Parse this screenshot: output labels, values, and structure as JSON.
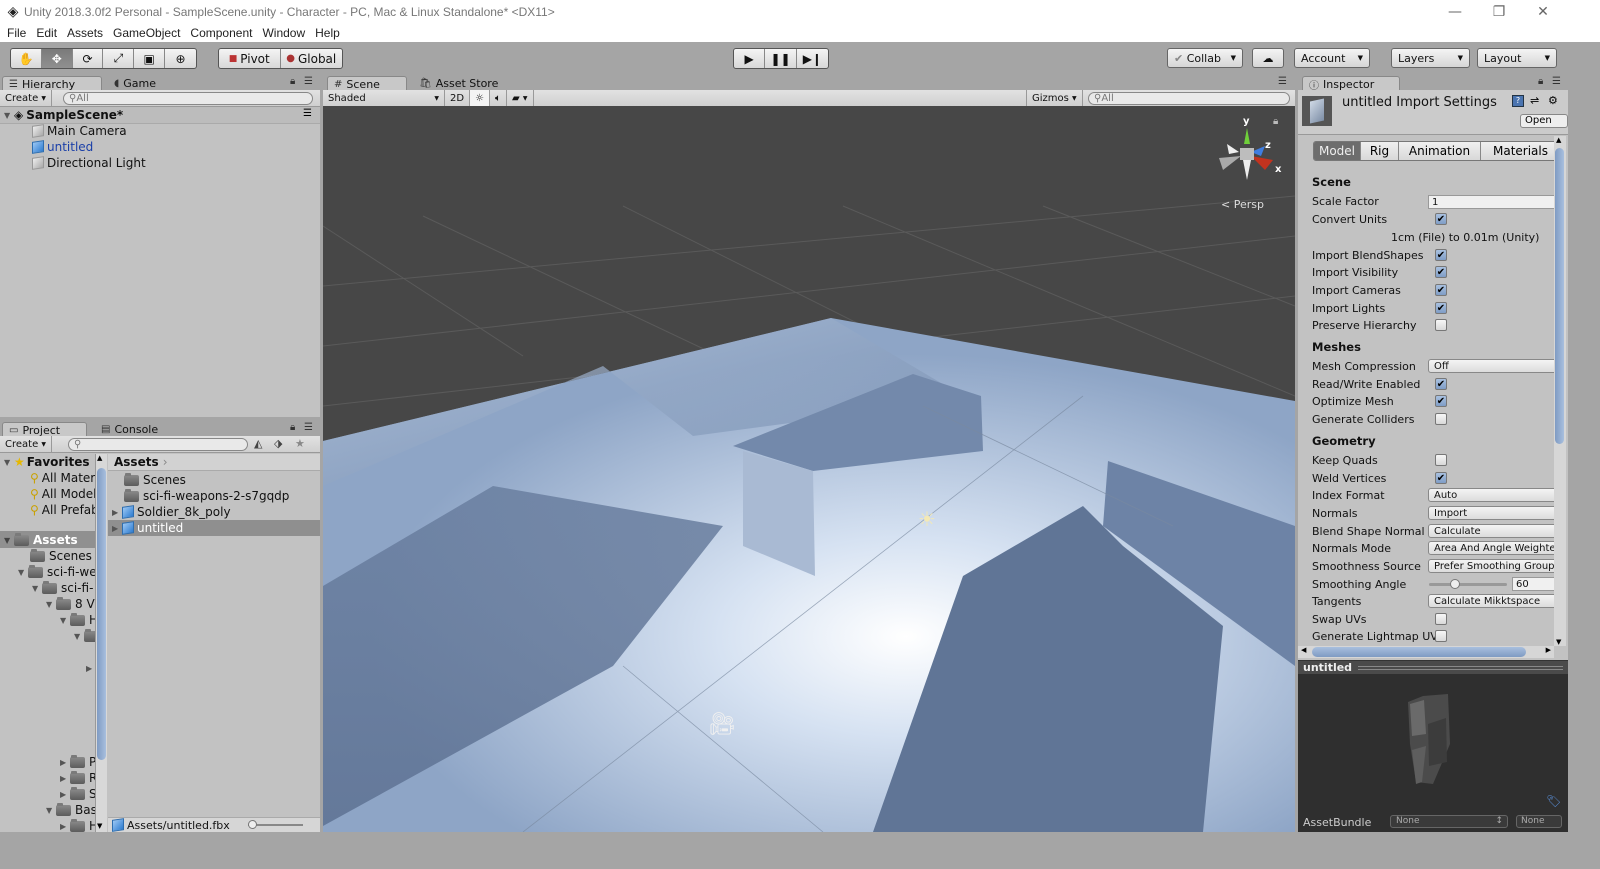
{
  "window": {
    "title": "Unity 2018.3.0f2 Personal - SampleScene.unity - Character - PC, Mac & Linux Standalone* <DX11>",
    "controls": [
      "minimize",
      "restore",
      "close"
    ]
  },
  "menubar": [
    "File",
    "Edit",
    "Assets",
    "GameObject",
    "Component",
    "Window",
    "Help"
  ],
  "toolbar": {
    "transform_tools": [
      "hand-tool",
      "move-tool",
      "rotate-tool",
      "scale-tool",
      "rect-tool",
      "transform-tool"
    ],
    "active_tool": "move-tool",
    "pivot_label": "Pivot",
    "global_label": "Global",
    "play_controls": [
      "play",
      "pause",
      "step"
    ],
    "collab_label": "Collab",
    "account_label": "Account",
    "layers_label": "Layers",
    "layout_label": "Layout"
  },
  "hierarchy": {
    "tabs": [
      {
        "label": "Hierarchy",
        "active": true
      },
      {
        "label": "Game",
        "active": false
      }
    ],
    "create_label": "Create",
    "search_placeholder": "All",
    "scene_name": "SampleScene*",
    "items": [
      {
        "label": "Main Camera",
        "selected": false
      },
      {
        "label": "untitled",
        "selected": true
      },
      {
        "label": "Directional Light",
        "selected": false
      }
    ]
  },
  "project": {
    "tabs": [
      {
        "label": "Project",
        "active": true
      },
      {
        "label": "Console",
        "active": false
      }
    ],
    "create_label": "Create",
    "search_placeholder": "",
    "favorites_label": "Favorites",
    "favorites": [
      "All Materials",
      "All Models",
      "All Prefabs"
    ],
    "assets_root": "Assets",
    "tree": [
      "Scenes",
      "sci-fi-we",
      "sci-fi-",
      "8 V",
      "H",
      "",
      "",
      "P",
      "R",
      "S",
      "Bas",
      "H"
    ],
    "breadcrumb": "Assets",
    "files": [
      {
        "label": "Scenes",
        "type": "folder"
      },
      {
        "label": "sci-fi-weapons-2-s7gqdp",
        "type": "folder"
      },
      {
        "label": "Soldier_8k_poly",
        "type": "model"
      },
      {
        "label": "untitled",
        "type": "model",
        "selected": true
      }
    ],
    "status_path": "Assets/untitled.fbx"
  },
  "scene": {
    "tabs": [
      {
        "label": "Scene",
        "active": true
      },
      {
        "label": "Asset Store",
        "active": false
      }
    ],
    "shading_mode": "Shaded",
    "mode_2d": "2D",
    "gizmos_label": "Gizmos",
    "search_placeholder": "All",
    "projection": "Persp",
    "axes": [
      "y",
      "z",
      "x"
    ]
  },
  "inspector": {
    "tab_label": "Inspector",
    "title": "untitled Import Settings",
    "open_label": "Open",
    "tabs": [
      "Model",
      "Rig",
      "Animation",
      "Materials"
    ],
    "active_tab": "Model",
    "sections": {
      "scene": {
        "heading": "Scene",
        "scale_factor_label": "Scale Factor",
        "scale_factor": "1",
        "convert_units_label": "Convert Units",
        "convert_units": true,
        "conversion_note": "1cm (File) to 0.01m (Unity)",
        "import_blendshapes_label": "Import BlendShapes",
        "import_blendshapes": true,
        "import_visibility_label": "Import Visibility",
        "import_visibility": true,
        "import_cameras_label": "Import Cameras",
        "import_cameras": true,
        "import_lights_label": "Import Lights",
        "import_lights": true,
        "preserve_hierarchy_label": "Preserve Hierarchy",
        "preserve_hierarchy": false
      },
      "meshes": {
        "heading": "Meshes",
        "mesh_compression_label": "Mesh Compression",
        "mesh_compression": "Off",
        "read_write_label": "Read/Write Enabled",
        "read_write": true,
        "optimize_mesh_label": "Optimize Mesh",
        "optimize_mesh": true,
        "generate_colliders_label": "Generate Colliders",
        "generate_colliders": false
      },
      "geometry": {
        "heading": "Geometry",
        "keep_quads_label": "Keep Quads",
        "keep_quads": false,
        "weld_vertices_label": "Weld Vertices",
        "weld_vertices": true,
        "index_format_label": "Index Format",
        "index_format": "Auto",
        "normals_label": "Normals",
        "normals": "Import",
        "blend_shape_normals_label": "Blend Shape Normal",
        "blend_shape_normals": "Calculate",
        "normals_mode_label": "Normals Mode",
        "normals_mode": "Area And Angle Weighted",
        "smoothness_source_label": "Smoothness Source",
        "smoothness_source": "Prefer Smoothing Groups",
        "smoothing_angle_label": "Smoothing Angle",
        "smoothing_angle": "60",
        "smoothing_angle_fraction": 0.33,
        "tangents_label": "Tangents",
        "tangents": "Calculate Mikktspace",
        "swap_uvs_label": "Swap UVs",
        "swap_uvs": false,
        "generate_lightmap_label": "Generate Lightmap UVs",
        "generate_lightmap": false
      }
    },
    "preview_title": "untitled",
    "assetbundle_label": "AssetBundle",
    "assetbundle_value": "None",
    "assetbundle_variant": "None"
  }
}
